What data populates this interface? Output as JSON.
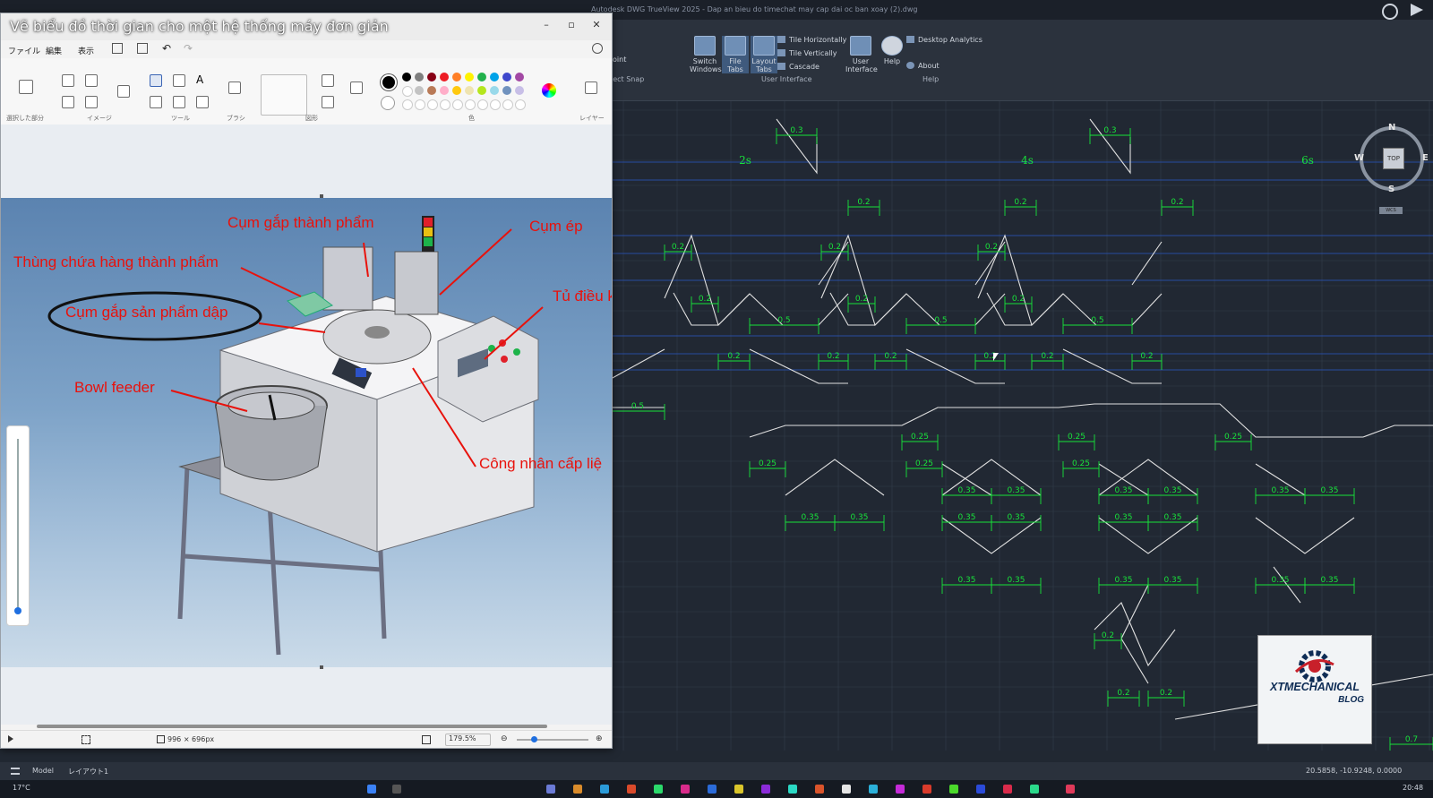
{
  "cad": {
    "window_title": "Autodesk DWG TrueView 2025 - Dap an bieu do timechat may cap dai oc ban xoay (2).dwg",
    "ribbon": {
      "switch_windows": "Switch Windows",
      "file_tabs": "File Tabs",
      "layout_tabs": "Layout Tabs",
      "tile_horizontally": "Tile Horizontally",
      "tile_vertically": "Tile Vertically",
      "cascade": "Cascade",
      "user_interface_button": "User Interface",
      "group_user_interface": "User Interface",
      "help_button": "Help",
      "desktop_analytics": "Desktop Analytics",
      "about": "About",
      "group_help": "Help",
      "group_object_snap": "ject Snap",
      "snap_btn": "oint"
    },
    "time_labels": [
      "2s",
      "4s",
      "6s"
    ],
    "dims": {
      "d03": "0.3",
      "d02": "0.2",
      "d05": "0.5",
      "d025": "0.25",
      "d035": "0.35",
      "d07": "0.7"
    },
    "viewcube": {
      "n": "N",
      "s": "S",
      "w": "W",
      "e": "E",
      "top": "TOP",
      "wcs": "WCS"
    },
    "status": {
      "tab_model": "Model",
      "tab_layout": "レイアウト1",
      "coords": "20.5858, -10.9248, 0.0000"
    },
    "colors": {
      "signal": "#e6e6e6",
      "dimension": "#18e23a",
      "grid": "#3a4453",
      "blue_lines": "#2c5fd0"
    }
  },
  "paint": {
    "title": "Vẽ biểu đồ thời gian cho một hệ thống máy đơn giản",
    "menu": [
      "ファイル",
      "編集",
      "表示"
    ],
    "groups": [
      "選択した部分",
      "イメージ",
      "ツール",
      "ブラシ",
      "図形",
      "色",
      "レイヤー"
    ],
    "image_labels": {
      "l1": "Cụm gắp thành phẩm",
      "l2": "Cụm ép",
      "l3": "Thùng chứa hàng thành phẩm",
      "l4": "Cụm gắp sản phẩm dập",
      "l5": "Tủ điều k",
      "l6": "Bowl feeder",
      "l7": "Công nhân cấp liệ"
    },
    "status": {
      "dims": "996 × 696px",
      "zoom": "179.5%"
    }
  },
  "logo": {
    "line1": "XTMECHANICAL",
    "line2": "BLOG"
  },
  "taskbar": {
    "weather": "17°C",
    "time": "20:48"
  }
}
